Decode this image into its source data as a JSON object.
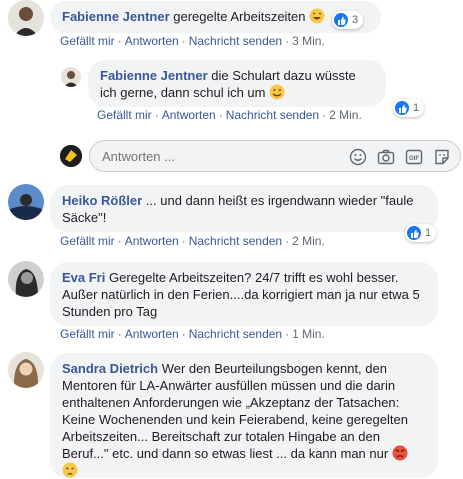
{
  "comments": [
    {
      "author": "Fabienne Jentner",
      "text": "geregelte Arbeitszeiten",
      "reaction_count": "3",
      "actions": {
        "like": "Gefällt mir",
        "reply": "Antworten",
        "message": "Nachricht senden",
        "time": "3 Min."
      }
    },
    {
      "author": "Fabienne Jentner",
      "text": "die Schulart dazu wüsste ich gerne, dann schul ich um",
      "reaction_count": "1",
      "actions": {
        "like": "Gefällt mir",
        "reply": "Antworten",
        "message": "Nachricht senden",
        "time": "2 Min."
      }
    },
    {
      "author": "Heiko Rößler",
      "text": "... und dann heißt es irgendwann wieder \"faule Säcke\"!",
      "reaction_count": "1",
      "actions": {
        "like": "Gefällt mir",
        "reply": "Antworten",
        "message": "Nachricht senden",
        "time": "2 Min."
      }
    },
    {
      "author": "Eva Fri",
      "text": "Geregelte Arbeitszeiten? 24/7 trifft es wohl besser. Außer natürlich in den Ferien....da korrigiert man ja nur etwa 5 Stunden pro Tag",
      "actions": {
        "like": "Gefällt mir",
        "reply": "Antworten",
        "message": "Nachricht senden",
        "time": "1 Min."
      }
    },
    {
      "author": "Sandra Dietrich",
      "text": "Wer den Beurteilungsbogen kennt, den Mentoren für LA-Anwärter ausfüllen müssen und die darin enthaltenen Anforderungen wie „Akzeptanz der Tatsachen: Keine Wochenenden und kein Feierabend, keine geregelten Arbeitszeiten... Bereitschaft zur totalen Hingabe an den Beruf...\" etc. und dann so etwas liest ... da kann man nur"
    }
  ],
  "reply": {
    "placeholder": "Antworten ..."
  },
  "colors": {
    "link": "#385898",
    "like": "#1877f2",
    "bubble": "#f2f3f5"
  },
  "icons": [
    "laughing-emoji-icon",
    "wink-emoji-icon",
    "angry-emoji-icon",
    "weary-emoji-icon",
    "like-icon",
    "smiley-icon",
    "camera-icon",
    "gif-icon",
    "sticker-icon"
  ]
}
